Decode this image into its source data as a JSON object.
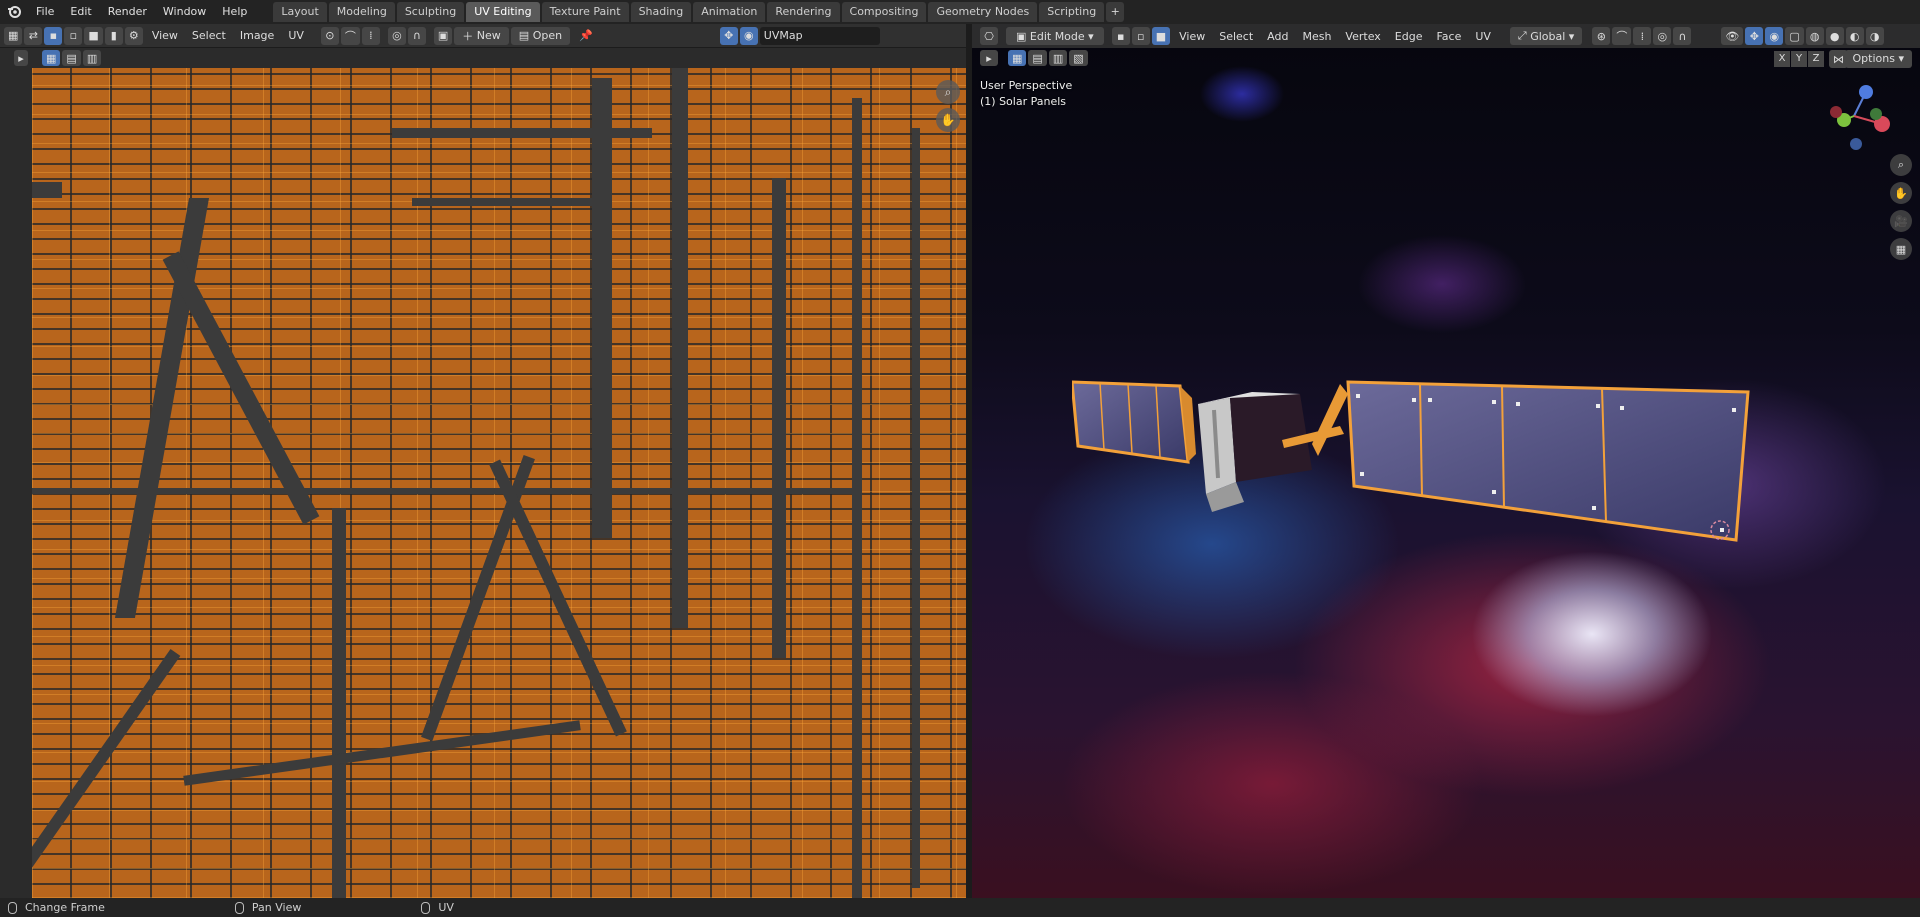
{
  "menu": {
    "items": [
      "File",
      "Edit",
      "Render",
      "Window",
      "Help"
    ]
  },
  "workspaces": {
    "tabs": [
      "Layout",
      "Modeling",
      "Sculpting",
      "UV Editing",
      "Texture Paint",
      "Shading",
      "Animation",
      "Rendering",
      "Compositing",
      "Geometry Nodes",
      "Scripting"
    ],
    "active": "UV Editing",
    "add_label": "+"
  },
  "uv_editor": {
    "menus": [
      "View",
      "Select",
      "Image",
      "UV"
    ],
    "new_label": "New",
    "open_label": "Open",
    "uvmap_name": "UVMap",
    "island_color": "#b8651c",
    "edge_color": "#ff9a2e"
  },
  "viewport": {
    "mode": "Edit Mode",
    "menus": [
      "View",
      "Select",
      "Add",
      "Mesh",
      "Vertex",
      "Edge",
      "Face",
      "UV"
    ],
    "orientation": "Global",
    "perspective_label": "User Perspective",
    "object_label": "(1) Solar Panels",
    "axis_x": "X",
    "axis_y": "Y",
    "axis_z": "Z",
    "options_label": "Options"
  },
  "statusbar": {
    "change_frame": "Change Frame",
    "pan_view": "Pan View",
    "uv": "UV"
  },
  "colors": {
    "accent": "#4772b3",
    "header": "#303030",
    "topbar": "#232323"
  }
}
